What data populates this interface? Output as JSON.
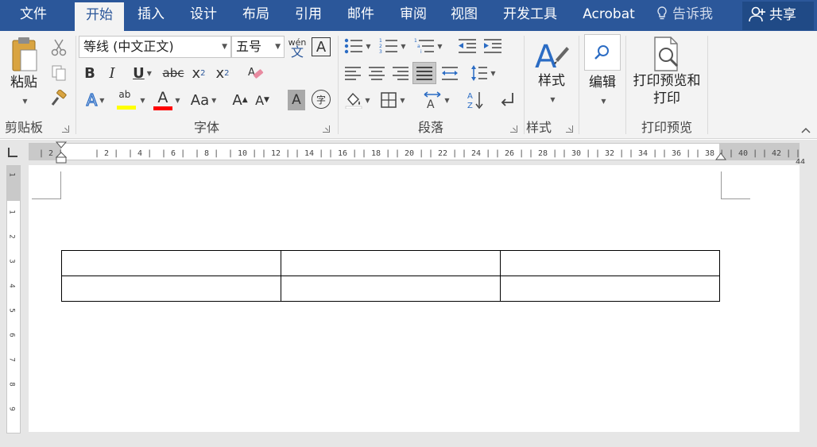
{
  "tabs": [
    "文件",
    "开始",
    "插入",
    "设计",
    "布局",
    "引用",
    "邮件",
    "审阅",
    "视图",
    "开发工具",
    "Acrobat"
  ],
  "active_tab": "开始",
  "tell_me": "告诉我",
  "share": "共享",
  "clipboard": {
    "paste": "粘贴",
    "label": "剪贴板"
  },
  "font": {
    "name": "等线 (中文正文)",
    "size": "五号",
    "phonetic_top": "wén",
    "phonetic_bottom": "文",
    "border_char": "A",
    "change_case": "Aa",
    "enclose_char": "字",
    "label": "字体"
  },
  "paragraph": {
    "label": "段落"
  },
  "styles": {
    "button": "样式",
    "label": "样式"
  },
  "editing": {
    "button": "编辑"
  },
  "print_preview": {
    "button_line1": "打印预览和",
    "button_line2": "打印",
    "label": "打印预览"
  },
  "ruler_h": [
    "2",
    "2",
    "4",
    "6",
    "8",
    "10",
    "12",
    "14",
    "16",
    "18",
    "20",
    "22",
    "24",
    "26",
    "28",
    "30",
    "32",
    "34",
    "36",
    "38",
    "40",
    "42",
    "44"
  ],
  "ruler_v": [
    "1",
    "1",
    "2",
    "3",
    "4",
    "5",
    "6",
    "7",
    "8",
    "9"
  ],
  "table": {
    "rows": 2,
    "cols": 3
  }
}
